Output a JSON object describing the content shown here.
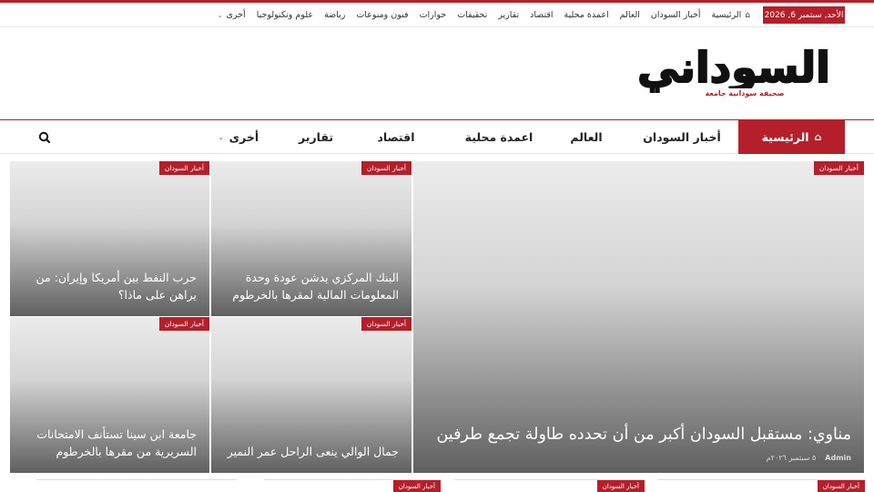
{
  "topbar": {
    "date": "الأحد, سبتمبر 6, 2026",
    "items": [
      "الرئيسية",
      "أخبار السودان",
      "العالم",
      "اعمدة محلية",
      "اقتصاد",
      "تقارير",
      "تحقيقات",
      "حوارات",
      "فنون ومنوعات",
      "رياضة",
      "علوم وتكنولوجيا",
      "أخرى"
    ]
  },
  "logo": {
    "main": "السوداني",
    "tagline": "صحيفة سودانية جامعة"
  },
  "nav": {
    "home": "الرئيسية",
    "items": [
      "أخبار السودان",
      "العالم",
      "اعمدة محلية",
      "اقتصاد",
      "تقارير",
      "أخرى"
    ]
  },
  "featured": {
    "category": "أخبار السودان",
    "title": "مناوي: مستقبل السودان أكبر من أن تحدده طاولة تجمع طرفين",
    "author": "Admin",
    "date": "٥ سبتمبر ٢٠٢٦م"
  },
  "cards": [
    {
      "category": "أخبار السودان",
      "title": "البنك المركزي يدشن عودة وحدة المعلومات المالية لمقرها بالخرطوم"
    },
    {
      "category": "أخبار السودان",
      "title": "حرب النفط بين أمريكا وإيران: من يراهن على ماذا؟"
    },
    {
      "category": "أخبار السودان",
      "title": "جمال الوالي ينعى الراحل عمر النمير"
    },
    {
      "category": "أخبار السودان",
      "title": "جامعة ابن سينا تستأنف الامتحانات السريرية من مقرها بالخرطوم"
    }
  ],
  "bottom": [
    {
      "category": "أخبار السودان"
    },
    {
      "category": "أخبار السودان"
    },
    {
      "category": "أخبار السودان"
    }
  ],
  "colors": {
    "accent": "#b51f2a"
  }
}
